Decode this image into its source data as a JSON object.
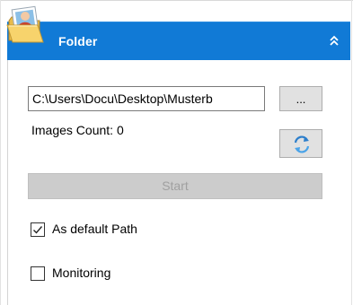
{
  "panel": {
    "title": "Folder",
    "header_color": "#117ad6",
    "icon": "folder-icon",
    "collapse_icon": "double-chevron-up-icon"
  },
  "path": {
    "value": "C:\\Users\\Docu\\Desktop\\Musterb"
  },
  "buttons": {
    "browse_label": "...",
    "refresh_icon": "refresh-icon",
    "start_label": "Start",
    "start_enabled": false
  },
  "images_count": {
    "label": "Images Count: 0"
  },
  "options": {
    "default_path": {
      "label": "As default Path",
      "checked": true
    },
    "monitoring": {
      "label": "Monitoring",
      "checked": false
    }
  }
}
